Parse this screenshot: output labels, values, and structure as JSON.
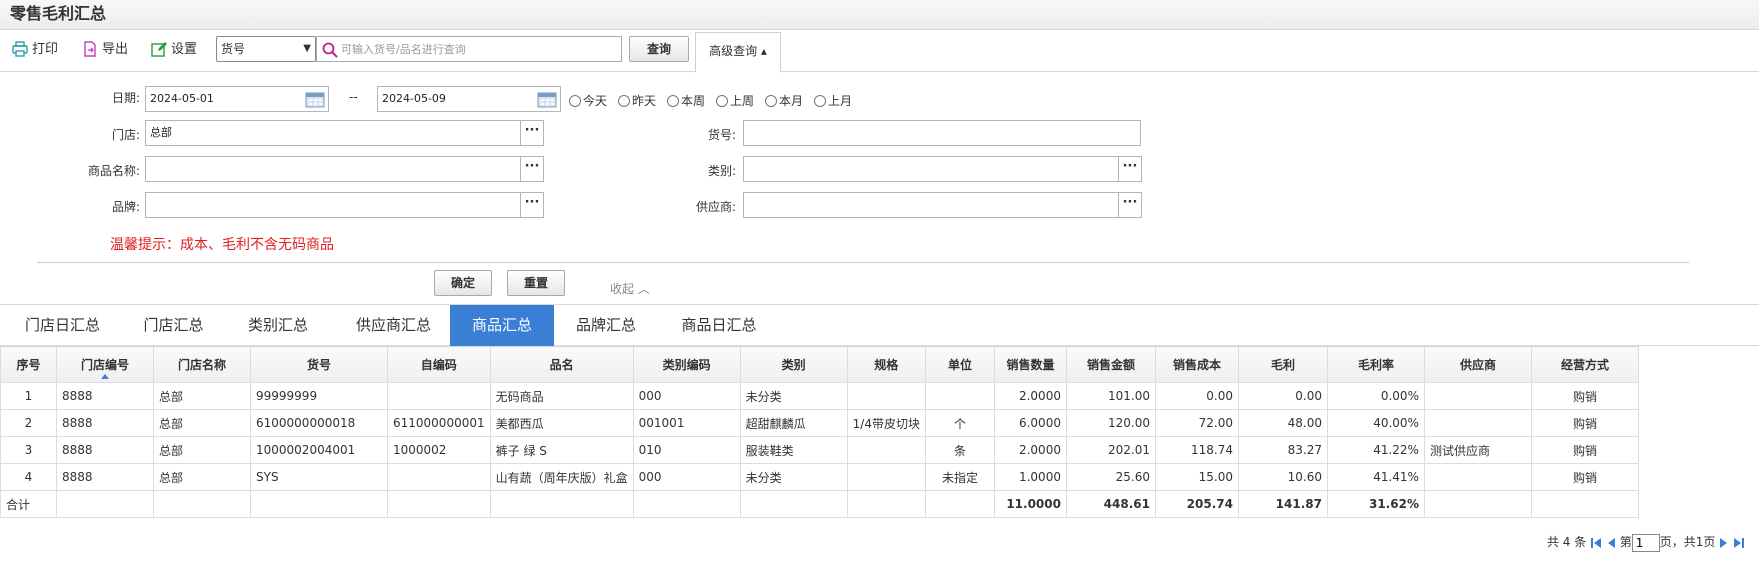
{
  "title": "零售毛利汇总",
  "toolbar": {
    "print": "打印",
    "export": "导出",
    "settings": "设置",
    "search_field": "货号",
    "search_placeholder": "可输入货号/品名进行查询",
    "query": "查询",
    "advanced": "高级查询 ▴"
  },
  "filter": {
    "date_label": "日期:",
    "date_from": "2024-05-01",
    "date_sep": "--",
    "date_to": "2024-05-09",
    "quick": [
      "今天",
      "昨天",
      "本周",
      "上周",
      "本月",
      "上月"
    ],
    "store_label": "门店:",
    "store_value": "总部",
    "sku_label": "货号:",
    "sku_value": "",
    "name_label": "商品名称:",
    "name_value": "",
    "category_label": "类别:",
    "category_value": "",
    "brand_label": "品牌:",
    "brand_value": "",
    "supplier_label": "供应商:",
    "supplier_value": "",
    "hint": "温馨提示：成本、毛利不含无码商品",
    "confirm": "确定",
    "reset": "重置",
    "collapse": "收起 ︿"
  },
  "tabs": [
    "门店日汇总",
    "门店汇总",
    "类别汇总",
    "供应商汇总",
    "商品汇总",
    "品牌汇总",
    "商品日汇总"
  ],
  "active_tab": 4,
  "columns": [
    "序号",
    "门店编号",
    "门店名称",
    "货号",
    "自编码",
    "品名",
    "类别编码",
    "类别",
    "规格",
    "单位",
    "销售数量",
    "销售金额",
    "销售成本",
    "毛利",
    "毛利率",
    "供应商",
    "经营方式"
  ],
  "rows": [
    [
      "1",
      "8888",
      "总部",
      "99999999",
      "",
      "无码商品",
      "000",
      "未分类",
      "",
      "",
      "2.0000",
      "101.00",
      "0.00",
      "0.00",
      "0.00%",
      "",
      "购销"
    ],
    [
      "2",
      "8888",
      "总部",
      "6100000000018",
      "611000000001",
      "美都西瓜",
      "001001",
      "超甜麒麟瓜",
      "1/4带皮切块",
      "个",
      "6.0000",
      "120.00",
      "72.00",
      "48.00",
      "40.00%",
      "",
      "购销"
    ],
    [
      "3",
      "8888",
      "总部",
      "1000002004001",
      "1000002",
      "裤子 绿 S",
      "010",
      "服装鞋类",
      "",
      "条",
      "2.0000",
      "202.01",
      "118.74",
      "83.27",
      "41.22%",
      "测试供应商",
      "购销"
    ],
    [
      "4",
      "8888",
      "总部",
      "SYS",
      "",
      "山有蔬（周年庆版）礼盒",
      "000",
      "未分类",
      "",
      "未指定",
      "1.0000",
      "25.60",
      "15.00",
      "10.60",
      "41.41%",
      "",
      "购销"
    ]
  ],
  "total": {
    "label": "合计",
    "qty": "11.0000",
    "amount": "448.61",
    "cost": "205.74",
    "profit": "141.87",
    "rate": "31.62%"
  },
  "pager": {
    "count_text": "共 4 条",
    "page_prefix": "第",
    "page": "1",
    "page_suffix": "页，共1页"
  },
  "colors": {
    "accent": "#3a7fd5",
    "hint": "#e02020"
  }
}
